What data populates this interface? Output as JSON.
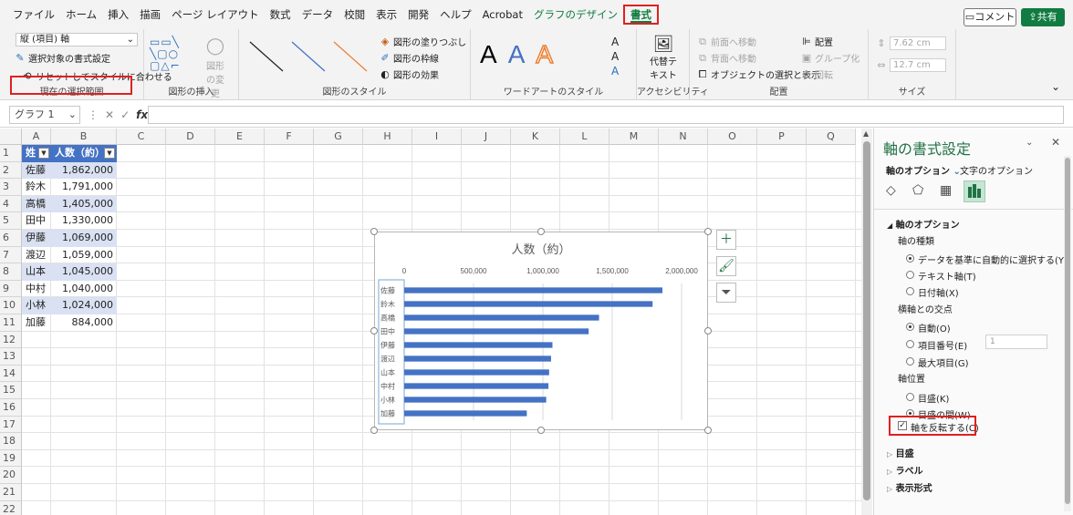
{
  "menu": {
    "items": [
      "ファイル",
      "ホーム",
      "挿入",
      "描画",
      "ページ レイアウト",
      "数式",
      "データ",
      "校閲",
      "表示",
      "開発",
      "ヘルプ",
      "Acrobat"
    ],
    "chart_design": "グラフのデザイン",
    "format": "書式",
    "comment": "コメント",
    "share": "共有"
  },
  "ribbon": {
    "selection_dropdown": "縦 (項目) 軸",
    "format_selection": "選択対象の書式設定",
    "reset_style": "リセットしてスタイルに合わせる",
    "group_current_selection": "現在の選択範囲",
    "change_shape": "図形の変更",
    "group_insert_shapes": "図形の挿入",
    "shape_fill": "図形の塗りつぶし",
    "shape_outline": "図形の枠線",
    "shape_effects": "図形の効果",
    "group_shape_styles": "図形のスタイル",
    "group_wordart": "ワードアートのスタイル",
    "alt_text_line1": "代替テ",
    "alt_text_line2": "キスト",
    "group_accessibility": "アクセシビリティ",
    "bring_forward": "前面へ移動",
    "send_backward": "背面へ移動",
    "selection_pane": "オブジェクトの選択と表示",
    "align": "配置",
    "group": "グループ化",
    "rotate": "回転",
    "group_arrange": "配置",
    "height": "7.62 cm",
    "width": "12.7 cm",
    "group_size": "サイズ"
  },
  "formula_bar": {
    "name_box": "グラフ 1",
    "fx": "fx",
    "value": ""
  },
  "sheet": {
    "columns": [
      "A",
      "B",
      "C",
      "D",
      "E",
      "F",
      "G",
      "H",
      "I",
      "J",
      "K",
      "L",
      "M",
      "N",
      "O",
      "P",
      "Q"
    ],
    "rows": [
      "1",
      "2",
      "3",
      "4",
      "5",
      "6",
      "7",
      "8",
      "9",
      "10",
      "11",
      "12",
      "13",
      "14",
      "15",
      "16",
      "17",
      "18",
      "19",
      "20",
      "21",
      "22"
    ],
    "header": [
      "姓",
      "人数（約）"
    ],
    "data": [
      [
        "佐藤",
        "1,862,000"
      ],
      [
        "鈴木",
        "1,791,000"
      ],
      [
        "高橋",
        "1,405,000"
      ],
      [
        "田中",
        "1,330,000"
      ],
      [
        "伊藤",
        "1,069,000"
      ],
      [
        "渡辺",
        "1,059,000"
      ],
      [
        "山本",
        "1,045,000"
      ],
      [
        "中村",
        "1,040,000"
      ],
      [
        "小林",
        "1,024,000"
      ],
      [
        "加藤",
        "884,000"
      ]
    ]
  },
  "chart_data": {
    "type": "bar",
    "orientation": "horizontal",
    "title": "人数（約）",
    "categories": [
      "佐藤",
      "鈴木",
      "高橋",
      "田中",
      "伊藤",
      "渡辺",
      "山本",
      "中村",
      "小林",
      "加藤"
    ],
    "values": [
      1862000,
      1791000,
      1405000,
      1330000,
      1069000,
      1059000,
      1045000,
      1040000,
      1024000,
      884000
    ],
    "xlim": [
      0,
      2000000
    ],
    "xticks": [
      0,
      500000,
      1000000,
      1500000,
      2000000
    ],
    "xtick_labels": [
      "0",
      "500,000",
      "1,000,000",
      "1,500,000",
      "2,000,000"
    ],
    "x_axis_position": "top",
    "category_axis_reversed": true,
    "grid": true,
    "bar_color": "#4472c4"
  },
  "pane": {
    "title": "軸の書式設定",
    "tab_axis_options": "軸のオプション",
    "tab_text_options": "文字のオプション",
    "section_axis_options": "軸のオプション",
    "axis_type_label": "軸の種類",
    "axis_type_options": [
      "データを基準に自動的に選択する(Y)",
      "テキスト軸(T)",
      "日付軸(X)"
    ],
    "axis_type_selected": 0,
    "cross_label": "横軸との交点",
    "cross_options": [
      "自動(O)",
      "項目番号(E)",
      "最大項目(G)"
    ],
    "cross_selected": 0,
    "cross_number": "1",
    "axis_position_label": "軸位置",
    "axis_position_options": [
      "目盛(K)",
      "目盛の間(W)"
    ],
    "axis_position_selected": 1,
    "reverse_label": "軸を反転する(C)",
    "reverse_checked": true,
    "collapsed_sections": [
      "目盛",
      "ラベル",
      "表示形式"
    ]
  },
  "colors": {
    "accent_green": "#217346",
    "table_header": "#4472c4",
    "band": "#d9e1f2",
    "highlight": "#e02020"
  }
}
